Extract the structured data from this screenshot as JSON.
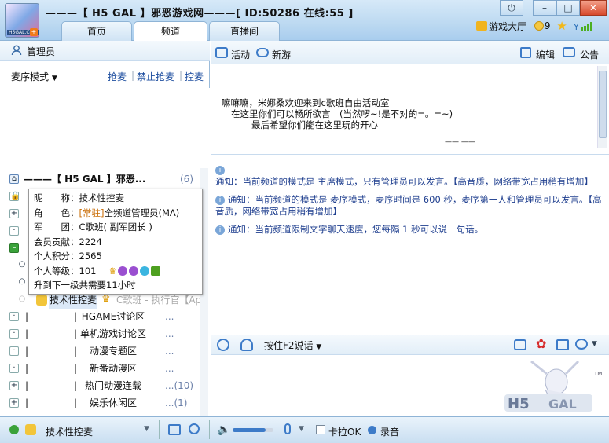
{
  "window": {
    "title": "———【 H5 GAL 】邪恶游戏网———[ ID:50286 在线:55 ]",
    "logo_text": "H5GAL.Com",
    "min": "–",
    "max": "□",
    "close": "✕"
  },
  "tabs": [
    "首页",
    "频道",
    "直播间"
  ],
  "topright": {
    "game_hall": "游戏大厅",
    "coins": "9"
  },
  "left": {
    "admin_label": "管理员",
    "mode_label": "麦序模式",
    "actions": [
      "抢麦",
      "禁止抢麦",
      "控麦"
    ]
  },
  "tree": {
    "root": {
      "label": "———【 H5 GAL 】邪恶...",
      "count": "(6)"
    },
    "current_user": {
      "name": "技术性控麦",
      "role": "C歌班 - 执行官【Ap"
    },
    "rooms": [
      {
        "label": "HGAME讨论区",
        "count": "..."
      },
      {
        "label": "单机游戏讨论区",
        "count": "..."
      },
      {
        "label": "动漫专题区",
        "count": "..."
      },
      {
        "label": "新番动漫区",
        "count": "..."
      },
      {
        "label": "热门动漫连载",
        "count": "...(10)"
      },
      {
        "label": "娱乐休闲区",
        "count": "...(1)"
      }
    ]
  },
  "popup": {
    "nickname_k": "昵　　称：",
    "nickname_v": "技术性控麦",
    "role_k": "角　　色：",
    "role_tag": "[常驻]",
    "role_v": "全频道管理员(MA)",
    "army_k": "军　　团：",
    "army_v": "C歌班( 副军团长 )",
    "contrib_k": "会员贡献：",
    "contrib_v": "2224",
    "points_k": "个人积分：",
    "points_v": "2565",
    "level_k": "个人等级：",
    "level_v": "101",
    "next": "升到下一级共需要11小时"
  },
  "main_toolbar": {
    "activity": "活动",
    "newgame": "新游",
    "edit": "编辑",
    "notice": "公告"
  },
  "announcement": [
    "嘛嘛嘛，米娜桑欢迎来到c歌班自由活动室",
    "在这里你们可以畅所欲言　(当然啰~!是不对的=。=~)",
    "最后希望你们能在这里玩的开心",
    "—— ——"
  ],
  "chat": [
    "通知：当前频道的模式是 主席模式，只有管理员可以发言。【高音质，网络带宽占用稍有增加】",
    "通知：当前频道的模式是 麦序模式，麦序时间是 600 秒，麦序第一人和管理员可以发言。【高音质，网络带宽占用稍有增加】",
    "通知：当前频道限制文字聊天速度，您每隔 1 秒可以说一句话。"
  ],
  "input_bar": {
    "ptt": "按住F2说话"
  },
  "status": {
    "user": "技术性控麦",
    "karaoke": "卡拉OK",
    "record": "录音",
    "volume": 0.8
  },
  "colors": {
    "accent": "#3d7bc8",
    "link": "#1f3f8f",
    "tag_orange": "#c86a00"
  }
}
